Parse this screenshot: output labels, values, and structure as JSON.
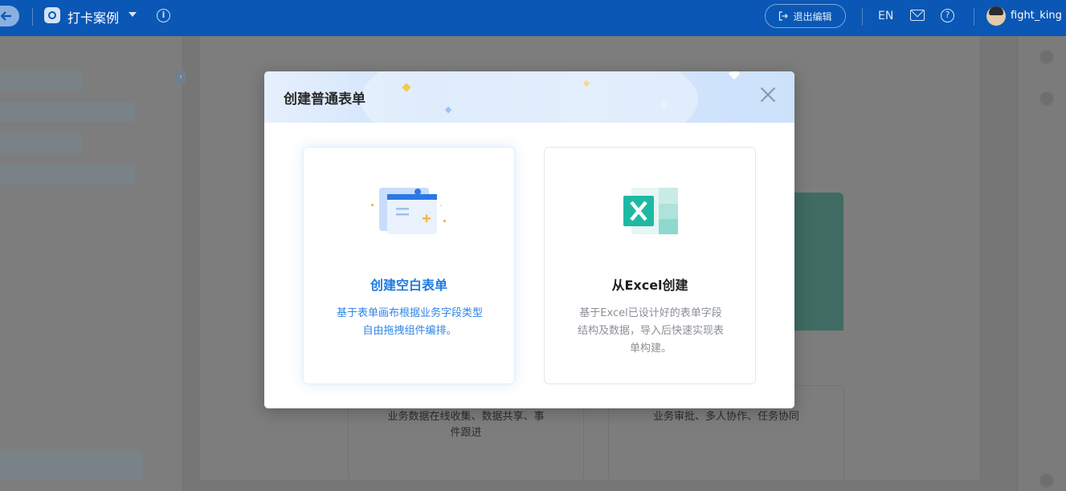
{
  "topbar": {
    "app_name": "打卡案例",
    "exit_edit_label": "退出编辑",
    "language": "EN",
    "username": "fight_king",
    "info_glyph": "i",
    "help_glyph": "?"
  },
  "background": {
    "card1_text": "业务数据在线收集、数据共享、事件跟进",
    "card2_text": "业务审批、多人协作、任务协同"
  },
  "modal": {
    "title": "创建普通表单",
    "options": [
      {
        "title": "创建空白表单",
        "description": "基于表单画布根据业务字段类型自由拖拽组件编排。",
        "icon": "blank-form-icon",
        "selected": true
      },
      {
        "title": "从Excel创建",
        "description": "基于Excel已设计好的表单字段结构及数据，导入后快速实现表单构建。",
        "icon": "excel-icon",
        "selected": false
      }
    ]
  },
  "colors": {
    "topbar": "#0a57b5",
    "accent": "#1f7be0",
    "excel_green": "#1fb9a3"
  }
}
